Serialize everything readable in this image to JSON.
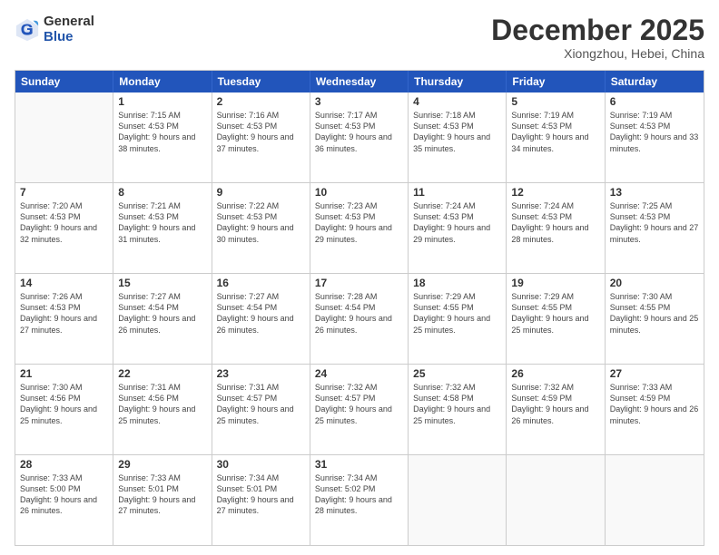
{
  "header": {
    "logo_general": "General",
    "logo_blue": "Blue",
    "month_title": "December 2025",
    "subtitle": "Xiongzhou, Hebei, China"
  },
  "days_of_week": [
    "Sunday",
    "Monday",
    "Tuesday",
    "Wednesday",
    "Thursday",
    "Friday",
    "Saturday"
  ],
  "weeks": [
    [
      {
        "day": "",
        "sunrise": "",
        "sunset": "",
        "daylight": ""
      },
      {
        "day": "1",
        "sunrise": "Sunrise: 7:15 AM",
        "sunset": "Sunset: 4:53 PM",
        "daylight": "Daylight: 9 hours and 38 minutes."
      },
      {
        "day": "2",
        "sunrise": "Sunrise: 7:16 AM",
        "sunset": "Sunset: 4:53 PM",
        "daylight": "Daylight: 9 hours and 37 minutes."
      },
      {
        "day": "3",
        "sunrise": "Sunrise: 7:17 AM",
        "sunset": "Sunset: 4:53 PM",
        "daylight": "Daylight: 9 hours and 36 minutes."
      },
      {
        "day": "4",
        "sunrise": "Sunrise: 7:18 AM",
        "sunset": "Sunset: 4:53 PM",
        "daylight": "Daylight: 9 hours and 35 minutes."
      },
      {
        "day": "5",
        "sunrise": "Sunrise: 7:19 AM",
        "sunset": "Sunset: 4:53 PM",
        "daylight": "Daylight: 9 hours and 34 minutes."
      },
      {
        "day": "6",
        "sunrise": "Sunrise: 7:19 AM",
        "sunset": "Sunset: 4:53 PM",
        "daylight": "Daylight: 9 hours and 33 minutes."
      }
    ],
    [
      {
        "day": "7",
        "sunrise": "Sunrise: 7:20 AM",
        "sunset": "Sunset: 4:53 PM",
        "daylight": "Daylight: 9 hours and 32 minutes."
      },
      {
        "day": "8",
        "sunrise": "Sunrise: 7:21 AM",
        "sunset": "Sunset: 4:53 PM",
        "daylight": "Daylight: 9 hours and 31 minutes."
      },
      {
        "day": "9",
        "sunrise": "Sunrise: 7:22 AM",
        "sunset": "Sunset: 4:53 PM",
        "daylight": "Daylight: 9 hours and 30 minutes."
      },
      {
        "day": "10",
        "sunrise": "Sunrise: 7:23 AM",
        "sunset": "Sunset: 4:53 PM",
        "daylight": "Daylight: 9 hours and 29 minutes."
      },
      {
        "day": "11",
        "sunrise": "Sunrise: 7:24 AM",
        "sunset": "Sunset: 4:53 PM",
        "daylight": "Daylight: 9 hours and 29 minutes."
      },
      {
        "day": "12",
        "sunrise": "Sunrise: 7:24 AM",
        "sunset": "Sunset: 4:53 PM",
        "daylight": "Daylight: 9 hours and 28 minutes."
      },
      {
        "day": "13",
        "sunrise": "Sunrise: 7:25 AM",
        "sunset": "Sunset: 4:53 PM",
        "daylight": "Daylight: 9 hours and 27 minutes."
      }
    ],
    [
      {
        "day": "14",
        "sunrise": "Sunrise: 7:26 AM",
        "sunset": "Sunset: 4:53 PM",
        "daylight": "Daylight: 9 hours and 27 minutes."
      },
      {
        "day": "15",
        "sunrise": "Sunrise: 7:27 AM",
        "sunset": "Sunset: 4:54 PM",
        "daylight": "Daylight: 9 hours and 26 minutes."
      },
      {
        "day": "16",
        "sunrise": "Sunrise: 7:27 AM",
        "sunset": "Sunset: 4:54 PM",
        "daylight": "Daylight: 9 hours and 26 minutes."
      },
      {
        "day": "17",
        "sunrise": "Sunrise: 7:28 AM",
        "sunset": "Sunset: 4:54 PM",
        "daylight": "Daylight: 9 hours and 26 minutes."
      },
      {
        "day": "18",
        "sunrise": "Sunrise: 7:29 AM",
        "sunset": "Sunset: 4:55 PM",
        "daylight": "Daylight: 9 hours and 25 minutes."
      },
      {
        "day": "19",
        "sunrise": "Sunrise: 7:29 AM",
        "sunset": "Sunset: 4:55 PM",
        "daylight": "Daylight: 9 hours and 25 minutes."
      },
      {
        "day": "20",
        "sunrise": "Sunrise: 7:30 AM",
        "sunset": "Sunset: 4:55 PM",
        "daylight": "Daylight: 9 hours and 25 minutes."
      }
    ],
    [
      {
        "day": "21",
        "sunrise": "Sunrise: 7:30 AM",
        "sunset": "Sunset: 4:56 PM",
        "daylight": "Daylight: 9 hours and 25 minutes."
      },
      {
        "day": "22",
        "sunrise": "Sunrise: 7:31 AM",
        "sunset": "Sunset: 4:56 PM",
        "daylight": "Daylight: 9 hours and 25 minutes."
      },
      {
        "day": "23",
        "sunrise": "Sunrise: 7:31 AM",
        "sunset": "Sunset: 4:57 PM",
        "daylight": "Daylight: 9 hours and 25 minutes."
      },
      {
        "day": "24",
        "sunrise": "Sunrise: 7:32 AM",
        "sunset": "Sunset: 4:57 PM",
        "daylight": "Daylight: 9 hours and 25 minutes."
      },
      {
        "day": "25",
        "sunrise": "Sunrise: 7:32 AM",
        "sunset": "Sunset: 4:58 PM",
        "daylight": "Daylight: 9 hours and 25 minutes."
      },
      {
        "day": "26",
        "sunrise": "Sunrise: 7:32 AM",
        "sunset": "Sunset: 4:59 PM",
        "daylight": "Daylight: 9 hours and 26 minutes."
      },
      {
        "day": "27",
        "sunrise": "Sunrise: 7:33 AM",
        "sunset": "Sunset: 4:59 PM",
        "daylight": "Daylight: 9 hours and 26 minutes."
      }
    ],
    [
      {
        "day": "28",
        "sunrise": "Sunrise: 7:33 AM",
        "sunset": "Sunset: 5:00 PM",
        "daylight": "Daylight: 9 hours and 26 minutes."
      },
      {
        "day": "29",
        "sunrise": "Sunrise: 7:33 AM",
        "sunset": "Sunset: 5:01 PM",
        "daylight": "Daylight: 9 hours and 27 minutes."
      },
      {
        "day": "30",
        "sunrise": "Sunrise: 7:34 AM",
        "sunset": "Sunset: 5:01 PM",
        "daylight": "Daylight: 9 hours and 27 minutes."
      },
      {
        "day": "31",
        "sunrise": "Sunrise: 7:34 AM",
        "sunset": "Sunset: 5:02 PM",
        "daylight": "Daylight: 9 hours and 28 minutes."
      },
      {
        "day": "",
        "sunrise": "",
        "sunset": "",
        "daylight": ""
      },
      {
        "day": "",
        "sunrise": "",
        "sunset": "",
        "daylight": ""
      },
      {
        "day": "",
        "sunrise": "",
        "sunset": "",
        "daylight": ""
      }
    ]
  ]
}
